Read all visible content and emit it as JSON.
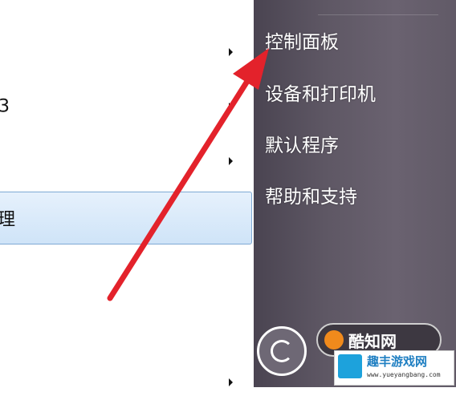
{
  "left_menu": {
    "items": [
      {
        "label": "",
        "has_submenu": true,
        "selected": false
      },
      {
        "label": "3",
        "has_submenu": true,
        "selected": false
      },
      {
        "label": "",
        "has_submenu": true,
        "selected": false
      },
      {
        "label": "理",
        "has_submenu": false,
        "selected": true
      },
      {
        "label": "",
        "has_submenu": true,
        "selected": false
      }
    ]
  },
  "right_menu": {
    "items": [
      {
        "label": "控制面板"
      },
      {
        "label": "设备和打印机"
      },
      {
        "label": "默认程序"
      },
      {
        "label": "帮助和支持"
      }
    ]
  },
  "annotation": {
    "arrow_color": "#e3222b",
    "points_to": "控制面板"
  },
  "watermark": {
    "badge_text": "酷知网",
    "site_name": "趣丰游戏网",
    "site_url": "www.yueyangbang.com"
  },
  "colors": {
    "right_pane": "#5e5764",
    "selection": "#cfe4f8",
    "arrow": "#e3222b"
  }
}
